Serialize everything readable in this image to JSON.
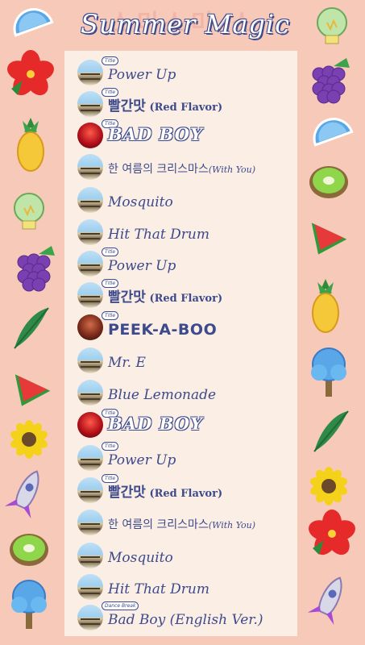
{
  "header": {
    "background_text": "소미소미 소",
    "title": "Summer Magic"
  },
  "tracks": [
    {
      "avatar": "blue",
      "badge": "Title",
      "title": "Power Up",
      "subtitle": "",
      "style": "script"
    },
    {
      "avatar": "blue",
      "badge": "Title",
      "title": "빨간맛",
      "subtitle": "(Red Flavor)",
      "style": "bold"
    },
    {
      "avatar": "red",
      "badge": "Title",
      "title": "BAD BOY",
      "subtitle": "",
      "style": "badboy"
    },
    {
      "avatar": "blue",
      "badge": "",
      "title": "한 여름의 크리스마스",
      "subtitle": "(With You)",
      "style": "kor"
    },
    {
      "avatar": "blue",
      "badge": "",
      "title": "Mosquito",
      "subtitle": "",
      "style": "script"
    },
    {
      "avatar": "blue",
      "badge": "",
      "title": "Hit That Drum",
      "subtitle": "",
      "style": "script"
    },
    {
      "avatar": "blue",
      "badge": "Title",
      "title": "Power Up",
      "subtitle": "",
      "style": "script"
    },
    {
      "avatar": "blue",
      "badge": "Title",
      "title": "빨간맛",
      "subtitle": "(Red Flavor)",
      "style": "bold"
    },
    {
      "avatar": "peek",
      "badge": "Title",
      "title": "PEEK-A-BOO",
      "subtitle": "",
      "style": "peek"
    },
    {
      "avatar": "blue",
      "badge": "",
      "title": "Mr. E",
      "subtitle": "",
      "style": "script"
    },
    {
      "avatar": "blue",
      "badge": "",
      "title": "Blue Lemonade",
      "subtitle": "",
      "style": "script"
    },
    {
      "avatar": "red",
      "badge": "Title",
      "title": "BAD BOY",
      "subtitle": "",
      "style": "badboy"
    },
    {
      "avatar": "blue",
      "badge": "Title",
      "title": "Power Up",
      "subtitle": "",
      "style": "script"
    },
    {
      "avatar": "blue",
      "badge": "Title",
      "title": "빨간맛",
      "subtitle": "(Red Flavor)",
      "style": "bold"
    },
    {
      "avatar": "blue",
      "badge": "",
      "title": "한 여름의 크리스마스",
      "subtitle": "(With You)",
      "style": "kor"
    },
    {
      "avatar": "blue",
      "badge": "",
      "title": "Mosquito",
      "subtitle": "",
      "style": "script"
    },
    {
      "avatar": "blue",
      "badge": "",
      "title": "Hit That Drum",
      "subtitle": "",
      "style": "script"
    },
    {
      "avatar": "blue",
      "badge": "Dance Break",
      "title": "Bad Boy (English Ver.)",
      "subtitle": "",
      "style": "script"
    }
  ],
  "decorations": {
    "left": [
      "orange-slice-icon",
      "hibiscus-icon",
      "pineapple-icon",
      "lightbulb-icon",
      "grapes-icon",
      "palm-leaf-icon",
      "watermelon-icon",
      "sunflower-icon",
      "rocket-icon",
      "kiwi-icon",
      "blue-tree-icon"
    ],
    "right": [
      "lightbulb-icon",
      "grapes-icon",
      "orange-slice-icon",
      "kiwi-icon",
      "watermelon-icon",
      "pineapple-icon",
      "blue-tree-icon",
      "palm-leaf-icon",
      "sunflower-icon",
      "hibiscus-icon",
      "rocket-icon"
    ]
  },
  "colors": {
    "background": "#f6c9b8",
    "panel": "#fbeee4",
    "text": "#3d4a8c"
  }
}
